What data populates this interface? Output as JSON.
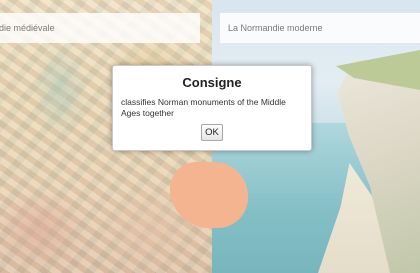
{
  "panels": {
    "left": {
      "label": "ndie médiévale"
    },
    "right": {
      "label": "La Normandie moderne"
    }
  },
  "dialog": {
    "title": "Consigne",
    "message": "classifies Norman monuments of the Middle Ages together",
    "ok_label": "OK"
  }
}
